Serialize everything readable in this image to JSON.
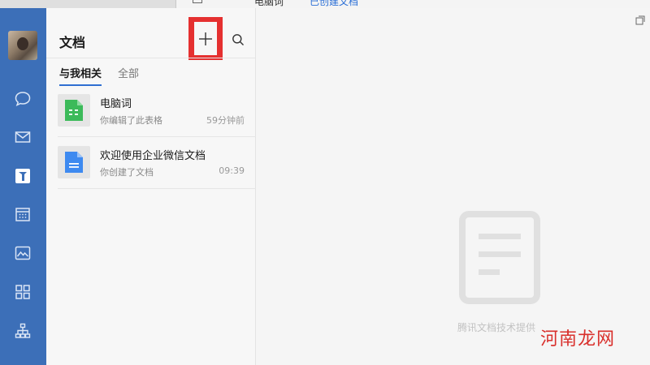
{
  "background_window": {
    "title": "电脑词",
    "link": "已创建文档"
  },
  "sidebar": {
    "avatar_label": "avatar",
    "items": [
      {
        "name": "messages",
        "icon": "chat-bubble-icon"
      },
      {
        "name": "mail",
        "icon": "mail-icon"
      },
      {
        "name": "docs",
        "icon": "docs-icon",
        "active": true
      },
      {
        "name": "calendar",
        "icon": "calendar-icon"
      },
      {
        "name": "drive",
        "icon": "drive-icon"
      },
      {
        "name": "workbench",
        "icon": "apps-grid-icon"
      },
      {
        "name": "contacts",
        "icon": "org-chart-icon"
      }
    ]
  },
  "panel": {
    "title": "文档",
    "tabs": [
      {
        "label": "与我相关",
        "active": true
      },
      {
        "label": "全部",
        "active": false
      }
    ],
    "docs": [
      {
        "name": "电脑词",
        "desc": "你编辑了此表格",
        "time": "59分钟前",
        "type": "sheet",
        "color": "#3cba5a"
      },
      {
        "name": "欢迎使用企业微信文档",
        "desc": "你创建了文档",
        "time": "09:39",
        "type": "doc",
        "color": "#3e8af0"
      }
    ]
  },
  "main": {
    "provided_by": "腾讯文档技术提供"
  },
  "watermark": "河南龙网",
  "colors": {
    "nav_bg": "#3c6fb8",
    "accent": "#2f6fd1",
    "highlight_box": "#e53030"
  }
}
